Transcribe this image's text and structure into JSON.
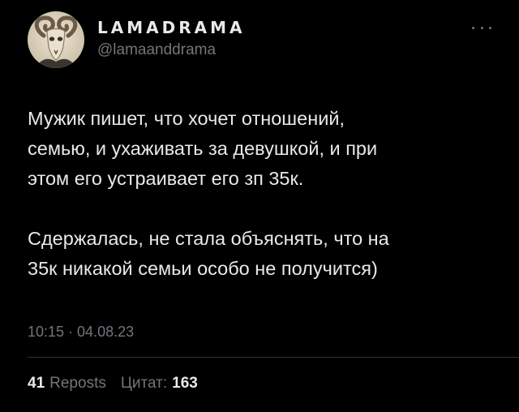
{
  "author": {
    "display_name": "LAMADRAMA",
    "handle": "@lamaanddrama",
    "avatar_icon": "ram-skull-avatar"
  },
  "menu": {
    "icon": "more-horizontal-icon"
  },
  "tweet": {
    "paragraphs": [
      "Мужик пишет, что хочет отношений,\nсемью, и ухаживать за девушкой, и при\nэтом его устраивает его зп 35к.",
      "Сдержалась, не стала объяснять, что на\n35к никакой семьи особо не получится)"
    ],
    "timestamp": "10:15 · 04.08.23"
  },
  "stats": {
    "reposts_count": "41",
    "reposts_label": "Reposts",
    "quotes_label": "Цитат:",
    "quotes_count": "163"
  },
  "colors": {
    "background": "#000000",
    "text_primary": "#e7e9ea",
    "text_secondary": "#71767b",
    "divider": "#2f3336"
  }
}
